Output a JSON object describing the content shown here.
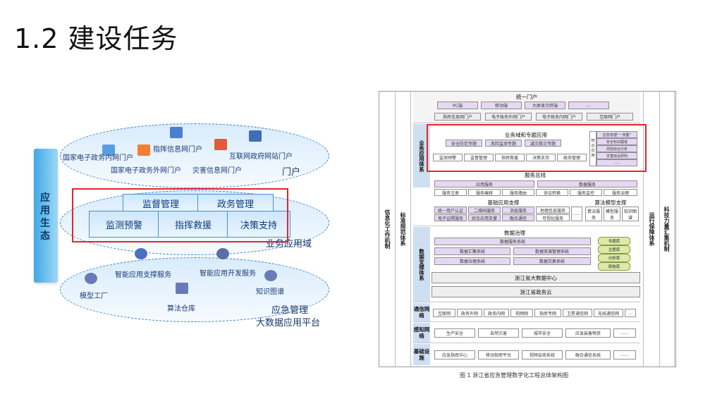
{
  "page": {
    "title": "1.2  建设任务"
  },
  "left_diagram": {
    "pillar_label": "应用生态",
    "portal_layer": {
      "title": "门户",
      "items": [
        "国家电子政务内网门户",
        "指挥信息网门户",
        "互联网政府网站门户",
        "国家电子政务外网门户",
        "灾害信息网门户"
      ]
    },
    "business_layer": {
      "title": "业务应用域",
      "cells": [
        "监督管理",
        "政务管理",
        "监测预警",
        "指挥救援",
        "决策支持"
      ]
    },
    "platform_layer": {
      "title_line1": "应急管理",
      "title_line2": "大数据应用平台",
      "items": [
        "智能应用支撑服务",
        "智能应用开发服务",
        "模型工厂",
        "知识图谱",
        "算法仓库"
      ]
    }
  },
  "right_diagram": {
    "left_bar_1": "信息化工作机制",
    "left_bar_2": "标准规范体系",
    "right_bar_1": "运行保障体系",
    "right_bar_2": "科技力量汇集机制",
    "portal": {
      "title": "统一门户",
      "items": [
        "PC端",
        "移动端",
        "大屏显示终端",
        "..."
      ],
      "subportals": [
        "指挥信息网门户",
        "电子政务外网门户",
        "电子政务内网门户",
        "互联网门户"
      ]
    },
    "business": {
      "label": "业务应用体系",
      "domain_title": "业务域和专题应用",
      "row1": [
        "安全防范专题",
        "风险监测专题",
        "减灾救灾专题"
      ],
      "row2": [
        "监测预警",
        "监督管理",
        "指挥救援",
        "决策支持",
        "政务管理"
      ],
      "side_title": "统合应用",
      "side_items": [
        "应急管理“一张图”",
        "安全知识图谱",
        "风险综合分析",
        "灾害综合研判",
        "……"
      ],
      "bus_title": "服务总线",
      "bus_row1": [
        "应用服务",
        "数据服务"
      ],
      "bus_row2": [
        "服务注册",
        "服务编排",
        "服务路由",
        "协议转换",
        "服务监控",
        "服务治理"
      ],
      "support_title": "基础应用支撑",
      "support_items": [
        "统一用户认证",
        "二维码服务",
        "消息服务",
        "地理信息服务",
        "电子证照服务",
        "综合应用支撑",
        "融合通信",
        "可视化服务",
        "……"
      ],
      "algo_title": "算法模型支撑",
      "algo_items": [
        "算法服务",
        "模型服务",
        "知识图谱"
      ]
    },
    "data": {
      "label": "数据支撑体系",
      "title": "数据治理",
      "rows": [
        "数据服务系统",
        "数据汇聚系统",
        "数据治理系统",
        "数据资源管理系统",
        "数据交换系统"
      ],
      "stores": [
        "专题库",
        "主题库",
        "分析库",
        "原始库"
      ],
      "center": "浙江省大数据中心",
      "cloud": "浙江省政务云"
    },
    "network": {
      "label": "通信网络",
      "items": [
        "互联网",
        "政务外网",
        "政务内网",
        "视频网",
        "指挥专网",
        "卫星通信网",
        "无线通信网",
        "..."
      ]
    },
    "sensing": {
      "label": "感知网络",
      "items": [
        "生产安全",
        "自然灾害",
        "城市安全",
        "应急装备物资",
        "……"
      ]
    },
    "infra": {
      "label": "基础设施",
      "items": [
        "应急指挥中心",
        "移动指挥平台",
        "视频会商系统",
        "融合通信系统",
        "……"
      ]
    }
  },
  "caption": "图 1 浙江省应急管理数字化工程总体架构图"
}
